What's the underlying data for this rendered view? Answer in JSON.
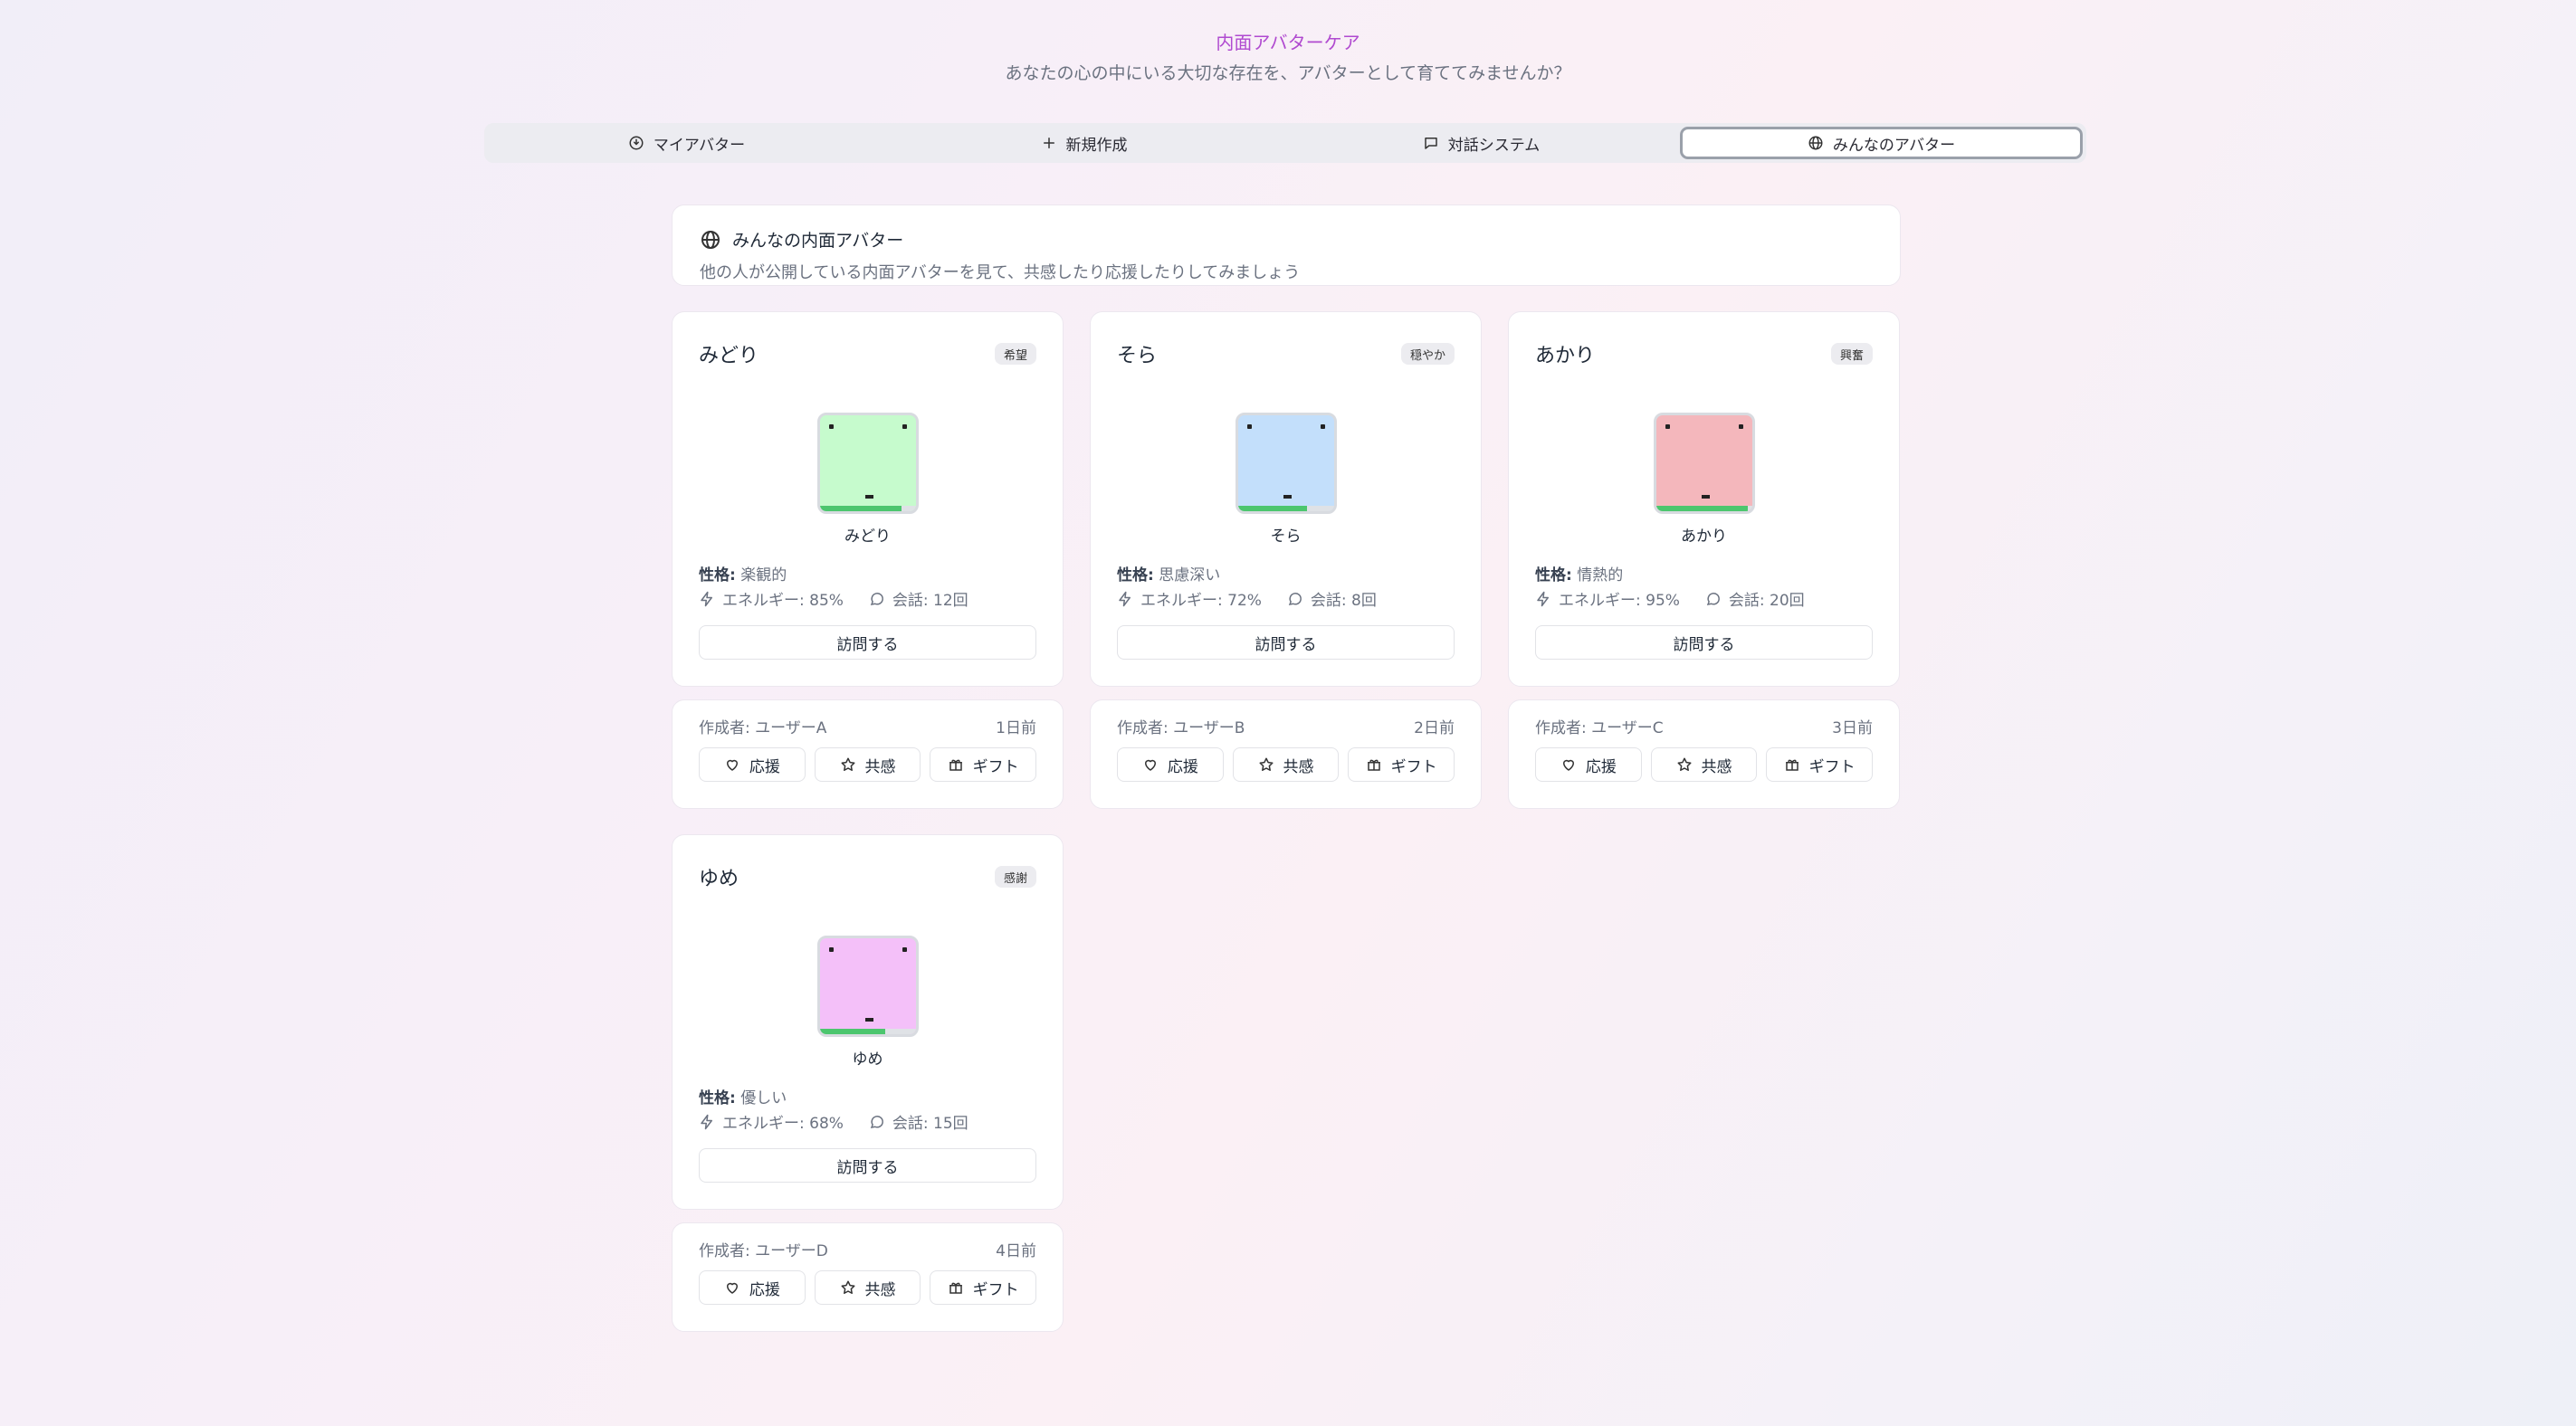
{
  "app": {
    "title": "内面アバターケア",
    "subtitle": "あなたの心の中にいる大切な存在を、アバターとして育ててみませんか？"
  },
  "tabs": [
    {
      "label": "マイアバター",
      "icon": "avatar-icon"
    },
    {
      "label": "新規作成",
      "icon": "plus-icon"
    },
    {
      "label": "対話システム",
      "icon": "message-square-icon"
    },
    {
      "label": "みんなのアバター",
      "icon": "globe-icon",
      "active": true
    }
  ],
  "intro": {
    "title": "みんなの内面アバター",
    "description": "他の人が公開している内面アバターを見て、共感したり応援したりしてみましょう"
  },
  "labels": {
    "trait_prefix": "性格:",
    "visit": "訪問する",
    "cheer": "応援",
    "empathy": "共感",
    "gift": "ギフト"
  },
  "avatars": [
    {
      "name": "みどり",
      "badge": "希望",
      "color": "#c6fbcd",
      "trait": "楽観的",
      "energy": 85,
      "energy_text": "エネルギー: 85%",
      "talks_text": "会話: 12回",
      "author": "作成者: ユーザーA",
      "time": "1日前"
    },
    {
      "name": "そら",
      "badge": "穏やか",
      "color": "#c3dffb",
      "trait": "思慮深い",
      "energy": 72,
      "energy_text": "エネルギー: 72%",
      "talks_text": "会話: 8回",
      "author": "作成者: ユーザーB",
      "time": "2日前"
    },
    {
      "name": "あかり",
      "badge": "興奮",
      "color": "#f4b7bc",
      "trait": "情熱的",
      "energy": 95,
      "energy_text": "エネルギー: 95%",
      "talks_text": "会話: 20回",
      "author": "作成者: ユーザーC",
      "time": "3日前"
    },
    {
      "name": "ゆめ",
      "badge": "感謝",
      "color": "#f4c0f9",
      "trait": "優しい",
      "energy": 68,
      "energy_text": "エネルギー: 68%",
      "talks_text": "会話: 15回",
      "author": "作成者: ユーザーD",
      "time": "4日前"
    }
  ]
}
